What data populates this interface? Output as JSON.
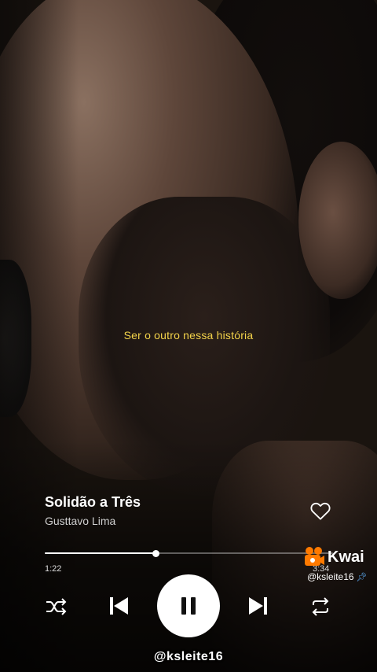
{
  "lyric": {
    "line": "Ser o outro nessa história",
    "color": "#f3d34a"
  },
  "track": {
    "title": "Solidão a Três",
    "artist": "Gusttavo Lima",
    "liked": false
  },
  "playback": {
    "elapsed": "1:22",
    "total": "3:34",
    "progress": 0.383,
    "state": "playing"
  },
  "controls": {
    "shuffle_icon": "shuffle-icon",
    "previous_icon": "skip-previous-icon",
    "play_pause_icon": "pause-icon",
    "next_icon": "skip-next-icon",
    "repeat_icon": "repeat-icon"
  },
  "kwai": {
    "brand": "Kwai",
    "handle": "@ksleite16",
    "brand_color": "#ff7a00"
  },
  "watermark": {
    "text": "@ksleite16"
  }
}
